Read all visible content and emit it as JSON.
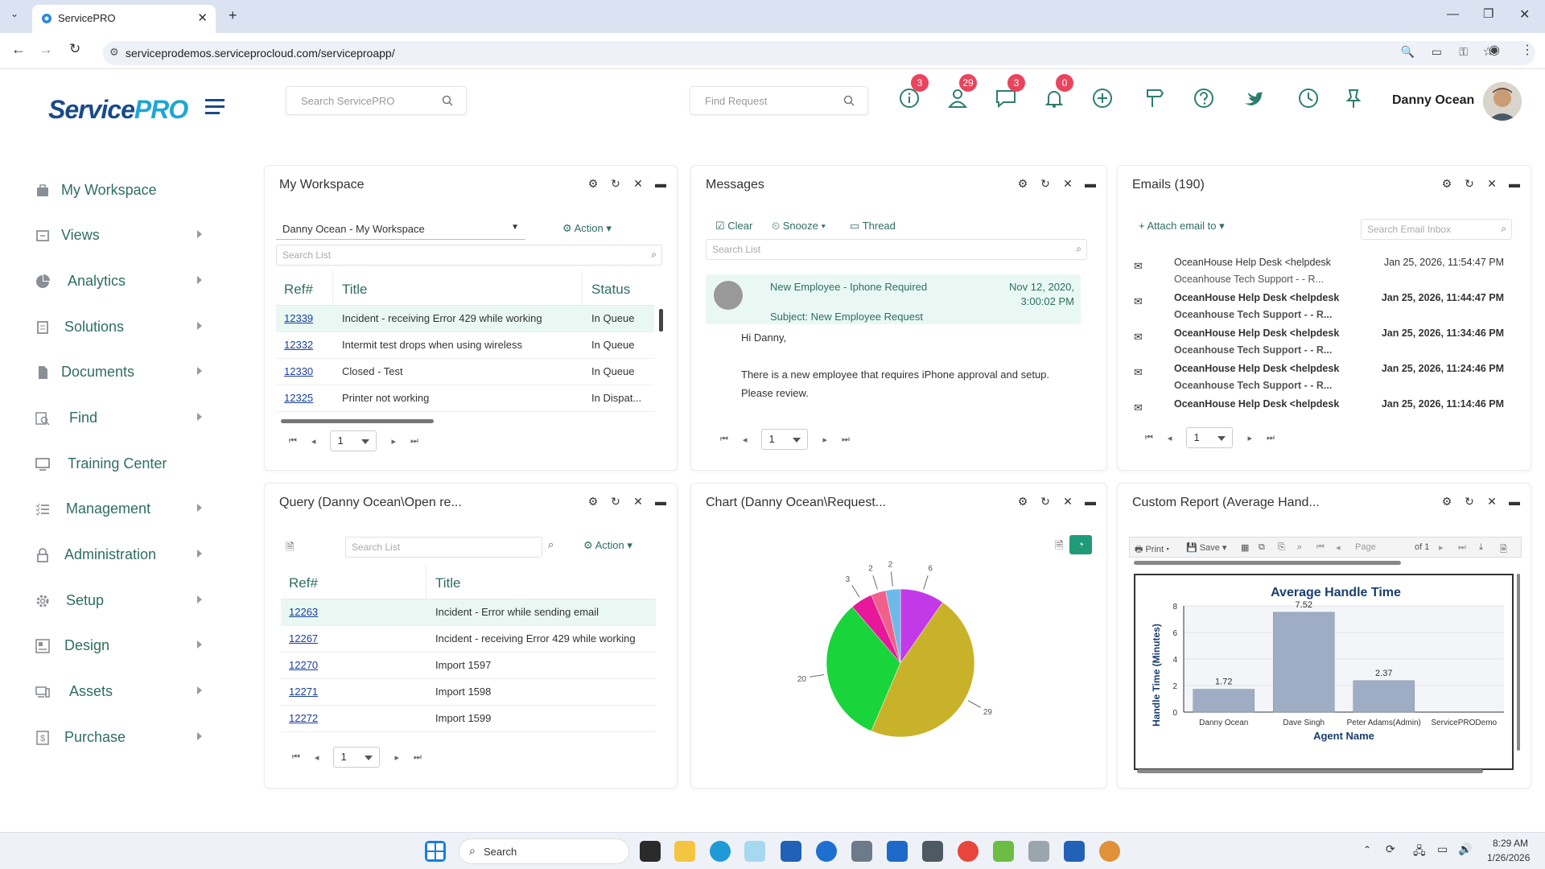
{
  "browser": {
    "tab_title": "ServicePRO",
    "url": "serviceprodemos.serviceprocloud.com/serviceproapp/"
  },
  "header": {
    "logo_text": "ServicePRO",
    "search_placeholder": "Search ServicePRO",
    "find_placeholder": "Find Request",
    "badges": {
      "info": "3",
      "users": "29",
      "chat": "3",
      "bell": "0"
    },
    "user_name": "Danny Ocean"
  },
  "sidebar": {
    "items": [
      {
        "label": "My Workspace"
      },
      {
        "label": "Views"
      },
      {
        "label": "Analytics"
      },
      {
        "label": "Solutions"
      },
      {
        "label": "Documents"
      },
      {
        "label": "Find"
      },
      {
        "label": "Training Center"
      },
      {
        "label": "Management"
      },
      {
        "label": "Administration"
      },
      {
        "label": "Setup"
      },
      {
        "label": "Design"
      },
      {
        "label": "Assets"
      },
      {
        "label": "Purchase"
      }
    ]
  },
  "workspace": {
    "title": "My Workspace",
    "dropdown": "Danny Ocean - My Workspace",
    "action": "Action",
    "search_placeholder": "Search List",
    "headers": {
      "ref": "Ref#",
      "title": "Title",
      "status": "Status"
    },
    "rows": [
      {
        "ref": "12339",
        "title": "Incident - receiving Error 429 while working",
        "status": "In Queue"
      },
      {
        "ref": "12332",
        "title": "Intermit test drops when using wireless",
        "status": "In Queue"
      },
      {
        "ref": "12330",
        "title": "Closed - Test",
        "status": "In Queue"
      },
      {
        "ref": "12325",
        "title": "Printer not working",
        "status": "In Dispat..."
      }
    ],
    "page": "1"
  },
  "messages": {
    "title": "Messages",
    "clear": "Clear",
    "snooze": "Snooze",
    "thread": "Thread",
    "search_placeholder": "Search List",
    "item": {
      "subject_line": "New Employee - Iphone Required",
      "date": "Nov 12, 2020,",
      "time": "3:00:02 PM",
      "subject": "Subject: New Employee Request"
    },
    "body_greeting": "Hi Danny,",
    "body_line1": "There is a new employee that requires iPhone approval and setup.",
    "body_line2": "Please review.",
    "page": "1"
  },
  "emails": {
    "title": "Emails (190)",
    "attach": "Attach email to",
    "search_placeholder": "Search Email Inbox",
    "rows": [
      {
        "from": "OceanHouse Help Desk <helpdesk",
        "date": "Jan 25, 2026, 11:54:47 PM",
        "subject": "Oceanhouse Tech Support - - R..."
      },
      {
        "from": "OceanHouse Help Desk <helpdesk",
        "date": "Jan 25, 2026, 11:44:47 PM",
        "subject": "Oceanhouse Tech Support - - R..."
      },
      {
        "from": "OceanHouse Help Desk <helpdesk",
        "date": "Jan 25, 2026, 11:34:46 PM",
        "subject": "Oceanhouse Tech Support - - R..."
      },
      {
        "from": "OceanHouse Help Desk <helpdesk",
        "date": "Jan 25, 2026, 11:24:46 PM",
        "subject": "Oceanhouse Tech Support - - R..."
      },
      {
        "from": "OceanHouse Help Desk <helpdesk",
        "date": "Jan 25, 2026, 11:14:46 PM",
        "subject": "Oceanhouse Tech Support - - R..."
      }
    ],
    "page": "1"
  },
  "query": {
    "title": "Query (Danny Ocean\\Open re...",
    "search_placeholder": "Search List",
    "action": "Action",
    "headers": {
      "ref": "Ref#",
      "title": "Title"
    },
    "rows": [
      {
        "ref": "12263",
        "title": "Incident - Error while sending email"
      },
      {
        "ref": "12267",
        "title": "Incident - receiving Error 429 while working"
      },
      {
        "ref": "12270",
        "title": "Import 1597"
      },
      {
        "ref": "12271",
        "title": "Import 1598"
      },
      {
        "ref": "12272",
        "title": "Import 1599"
      }
    ],
    "page": "1"
  },
  "chart_panel": {
    "title": "Chart (Danny Ocean\\Request..."
  },
  "report_panel": {
    "title": "Custom Report (Average Hand...",
    "print": "Print",
    "save": "Save",
    "page_label": "Page",
    "of_label": "of 1"
  },
  "taskbar": {
    "search": "Search",
    "time": "8:29 AM",
    "date": "1/26/2026"
  },
  "chart_data": [
    {
      "type": "pie",
      "values": [
        6,
        29,
        20,
        3,
        2,
        2
      ],
      "colors": [
        "#c23ae8",
        "#c8b22a",
        "#19d43a",
        "#e8189a",
        "#f0608a",
        "#6fb8e8"
      ],
      "labels": [
        "6",
        "29",
        "20",
        "3",
        "2",
        "2"
      ]
    },
    {
      "type": "bar",
      "title": "Average Handle Time",
      "xlabel": "Agent Name",
      "ylabel": "Handle Time (Minutes)",
      "categories": [
        "Danny Ocean",
        "Dave Singh",
        "Peter Adams(Admin)",
        "ServicePRODemo"
      ],
      "values": [
        1.72,
        7.52,
        2.37,
        null
      ],
      "value_labels": [
        "1.72",
        "7.52",
        "2.37",
        ""
      ],
      "ylim": [
        0,
        8
      ],
      "yticks": [
        "8",
        "6",
        "4",
        "2",
        "0"
      ]
    }
  ]
}
